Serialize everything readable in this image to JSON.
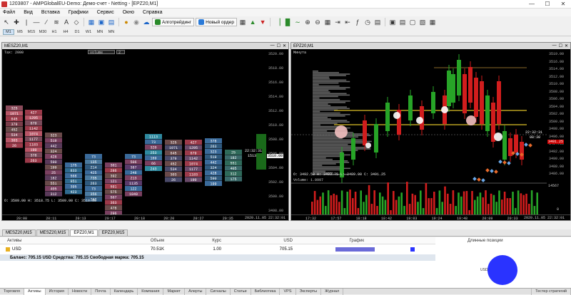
{
  "window": {
    "title": "1203807 - AMPGlobalEU-Demo: Демо-счет - Netting - [EPZ20,M1]"
  },
  "menu": [
    "Файл",
    "Вид",
    "Вставка",
    "Графики",
    "Сервис",
    "Окно",
    "Справка"
  ],
  "toolbar": {
    "algo_label": "Алготрейдинг",
    "new_order_label": "Новый ордер"
  },
  "timeframes": [
    "M1",
    "M5",
    "M15",
    "M30",
    "H1",
    "H4",
    "D1",
    "W1",
    "MN",
    "MN"
  ],
  "charts": {
    "left": {
      "title": "MESZ20,M1",
      "subheader": "Tax: 2000",
      "volume_label": "volume",
      "volume_value": "2",
      "status": "O: 3509.00  H: 3518.75  L: 3509.00  C: 3510.00",
      "time_labels": [
        "20:08",
        "20:11",
        "20:13",
        "20:17",
        "20:18",
        "20:20",
        "20:27",
        "20:35"
      ],
      "date_label": "2020.11.05 22:32:01",
      "price_labels": [
        "3520.00",
        "3518.00",
        "3516.00",
        "3514.00",
        "3512.00",
        "3510.00",
        "3508.00",
        "3506.00",
        "3504.00",
        "3502.00",
        "3500.00",
        "3498.00"
      ],
      "price_tag": "3510.00",
      "clock": "22:32:31",
      "clock_value": "1513",
      "cluster_values": [
        "325",
        "1071",
        "645",
        "379",
        "452",
        "534",
        "303",
        "26",
        "427",
        "1295",
        "679",
        "1142",
        "1074",
        "1177",
        "1183",
        "190",
        "378",
        "263",
        "323",
        "519",
        "442",
        "324",
        "428",
        "590",
        "199",
        "25",
        "182",
        "551",
        "405",
        "312",
        "175",
        "833",
        "568",
        "951",
        "395",
        "423",
        "73",
        "135",
        "214",
        "425",
        "735",
        "263",
        "73",
        "356",
        "262",
        "301",
        "286",
        "392",
        "121",
        "591",
        "575",
        "567",
        "363",
        "478",
        "296",
        "732",
        "73",
        "506",
        "387",
        "248",
        "213",
        "1135",
        "122",
        "1049",
        "1113",
        "73",
        "320",
        "253",
        "169",
        "66",
        "243"
      ]
    },
    "right": {
      "title": "EPZ20,M1",
      "subheader": "Минута",
      "status": "O: 3492.50  H: 3493.75  L: 3489.00  C: 3491.25",
      "volume_status": "Volume: 1.0997",
      "time_labels": [
        "17:32",
        "17:57",
        "18:18",
        "18:42",
        "19:03",
        "19:24",
        "19:48",
        "20:09",
        "20:33"
      ],
      "date_label": "2020.11.05 22:32:01",
      "price_labels": [
        "3519.00",
        "3516.00",
        "3514.00",
        "3512.00",
        "3510.00",
        "3508.00",
        "3506.00",
        "3504.00",
        "3502.00",
        "3500.00",
        "3498.00",
        "3496.00",
        "3494.00",
        "3492.00",
        "3490.00",
        "3488.00",
        "3486.00"
      ],
      "price_tag": "3491.25",
      "clock": "22:32:31",
      "clock_sub": "08:30",
      "volume_scale": [
        "14567",
        "0"
      ]
    }
  },
  "chart_tabs": [
    "MESZ20,M15",
    "MESZ20,M15",
    "EPZ20,M1",
    "EPZ20,M15"
  ],
  "active_chart_tab": 2,
  "terminal": {
    "headers": [
      "Активы",
      "Объем",
      "Курс",
      "USD",
      "График"
    ],
    "rows": [
      {
        "asset": "USD",
        "volume": "70.51K",
        "rate": "1.00",
        "usd": "705.15",
        "bar": 0.58
      }
    ],
    "balance_line": "Баланс: 705.15 USD  Средства: 705.15  Свободная маржа: 705.15",
    "positions_title": "Длинные позиции",
    "pie_label": "USD"
  },
  "bottom_tabs": [
    "Торговля",
    "Активы",
    "История",
    "Новости",
    "Почта",
    "Календарь",
    "Компания",
    "Маркет",
    "Алерты",
    "Сигналы",
    "Статьи",
    "Библиотека",
    "VPS",
    "Эксперты",
    "Журнал"
  ],
  "active_bottom_tab": 1,
  "strategy_tester": "Тестер стратегий",
  "colors": {
    "bull": "#27a427",
    "bear": "#d11d1d",
    "volume_up": "#d11d1d",
    "pie": "#2a33ff",
    "bar": "#6a6ad8"
  }
}
